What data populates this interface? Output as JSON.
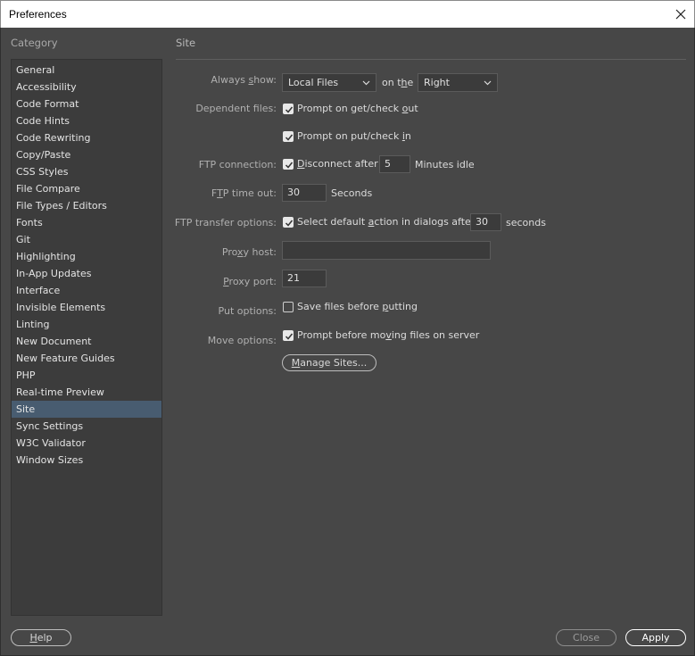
{
  "window": {
    "title": "Preferences"
  },
  "sidebar": {
    "heading": "Category",
    "items": [
      "General",
      "Accessibility",
      "Code Format",
      "Code Hints",
      "Code Rewriting",
      "Copy/Paste",
      "CSS Styles",
      "File Compare",
      "File Types / Editors",
      "Fonts",
      "Git",
      "Highlighting",
      "In-App Updates",
      "Interface",
      "Invisible Elements",
      "Linting",
      "New Document",
      "New Feature Guides",
      "PHP",
      "Real-time Preview",
      "Site",
      "Sync Settings",
      "W3C Validator",
      "Window Sizes"
    ],
    "selected": "Site"
  },
  "site": {
    "title": "Site",
    "always_show": {
      "label": "Always show:",
      "value": "Local Files",
      "on_the": "on the",
      "side": "Right"
    },
    "dependent_files": {
      "label": "Dependent files:",
      "opt1": "Prompt on get/check out",
      "opt1_checked": true,
      "opt2": "Prompt on put/check in",
      "opt2_checked": true
    },
    "ftp_connection": {
      "label": "FTP connection:",
      "option": "Disconnect after",
      "checked": true,
      "value": "5",
      "suffix": "Minutes idle"
    },
    "ftp_timeout": {
      "label": "FTP time out:",
      "value": "30",
      "suffix": "Seconds"
    },
    "ftp_transfer": {
      "label": "FTP transfer options:",
      "option": "Select default action in dialogs after",
      "checked": true,
      "value": "30",
      "suffix": "seconds"
    },
    "proxy_host": {
      "label": "Proxy host:",
      "value": ""
    },
    "proxy_port": {
      "label": "Proxy port:",
      "value": "21"
    },
    "put_options": {
      "label": "Put options:",
      "option": "Save files before putting",
      "checked": false
    },
    "move_options": {
      "label": "Move options:",
      "option": "Prompt before moving files on server",
      "checked": true
    },
    "manage_sites": "Manage Sites..."
  },
  "footer": {
    "help": "Help",
    "close": "Close",
    "apply": "Apply"
  }
}
